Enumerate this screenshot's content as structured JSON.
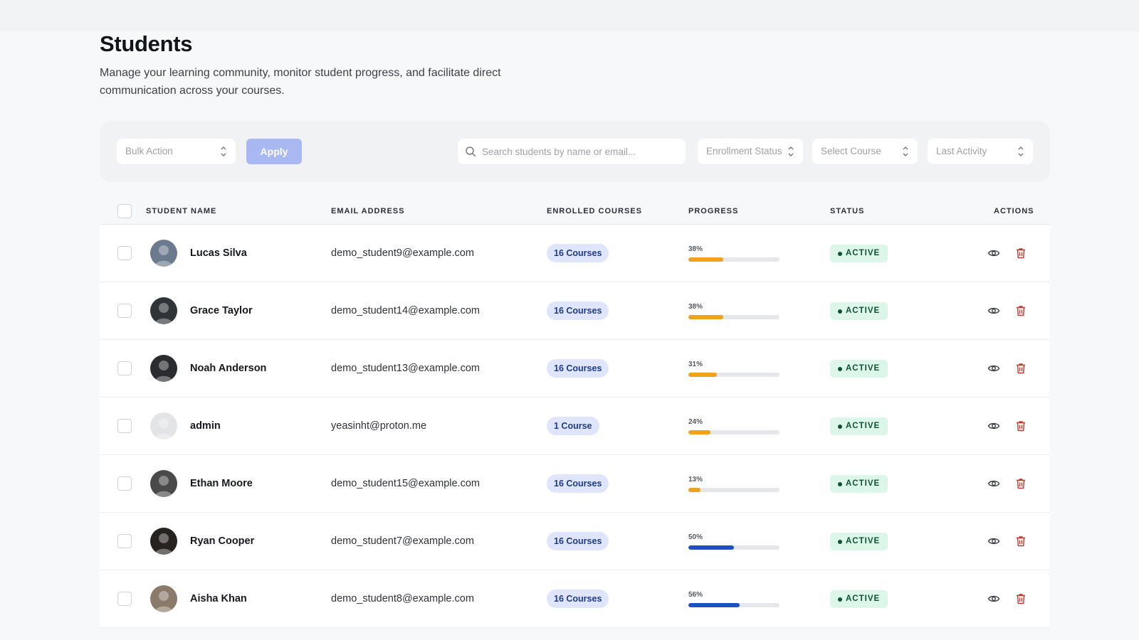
{
  "header": {
    "title": "Students",
    "subtitle": "Manage your learning community, monitor student progress, and facilitate direct communication across your courses."
  },
  "filters": {
    "bulk_action": "Bulk Action",
    "apply": "Apply",
    "search_placeholder": "Search students by name or email...",
    "enrollment_status": "Enrollment Status",
    "select_course": "Select Course",
    "last_activity": "Last Activity"
  },
  "table": {
    "columns": {
      "student_name": "STUDENT NAME",
      "email": "EMAIL ADDRESS",
      "enrolled": "ENROLLED COURSES",
      "progress": "PROGRESS",
      "status": "STATUS",
      "actions": "ACTIONS"
    },
    "rows": [
      {
        "name": "Lucas Silva",
        "email": "demo_student9@example.com",
        "courses": "16 Courses",
        "progress_label": "38%",
        "progress": 0.38,
        "status": "ACTIVE",
        "avatar_color": "#6b7a8c"
      },
      {
        "name": "Grace Taylor",
        "email": "demo_student14@example.com",
        "courses": "16 Courses",
        "progress_label": "38%",
        "progress": 0.38,
        "status": "ACTIVE",
        "avatar_color": "#2f3438"
      },
      {
        "name": "Noah Anderson",
        "email": "demo_student13@example.com",
        "courses": "16 Courses",
        "progress_label": "31%",
        "progress": 0.31,
        "status": "ACTIVE",
        "avatar_color": "#2a2c2f"
      },
      {
        "name": "admin",
        "email": "yeasinht@proton.me",
        "courses": "1 Course",
        "progress_label": "24%",
        "progress": 0.24,
        "status": "ACTIVE",
        "avatar_color": "#e3e4e6"
      },
      {
        "name": "Ethan Moore",
        "email": "demo_student15@example.com",
        "courses": "16 Courses",
        "progress_label": "13%",
        "progress": 0.13,
        "status": "ACTIVE",
        "avatar_color": "#4a4a4a"
      },
      {
        "name": "Ryan Cooper",
        "email": "demo_student7@example.com",
        "courses": "16 Courses",
        "progress_label": "50%",
        "progress": 0.5,
        "status": "ACTIVE",
        "avatar_color": "#26221f"
      },
      {
        "name": "Aisha Khan",
        "email": "demo_student8@example.com",
        "courses": "16 Courses",
        "progress_label": "56%",
        "progress": 0.56,
        "status": "ACTIVE",
        "avatar_color": "#8a7a6a"
      }
    ]
  },
  "colors": {
    "progress_low": "#f0a21b",
    "progress_high": "#1f4fc4",
    "delete": "#c0392b"
  }
}
